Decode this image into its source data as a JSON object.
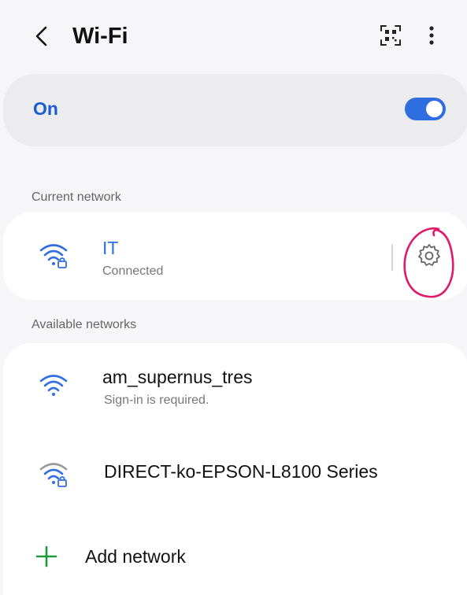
{
  "header": {
    "title": "Wi-Fi",
    "back_icon": "chevron-left-icon",
    "qr_icon": "qr-scan-icon",
    "more_icon": "more-vertical-icon"
  },
  "wifi_toggle": {
    "label": "On",
    "enabled": true,
    "accent_color": "#2f6ee0",
    "label_color": "#1c5bd6"
  },
  "current_network": {
    "section_label": "Current network",
    "name": "IT",
    "status": "Connected",
    "icon": "wifi-lock-icon",
    "settings_icon": "gear-icon",
    "name_color": "#2f6ee0"
  },
  "available_networks": {
    "section_label": "Available networks",
    "items": [
      {
        "name": "am_supernus_tres",
        "subtitle": "Sign-in is required.",
        "icon": "wifi-icon"
      },
      {
        "name": "DIRECT-ko-EPSON-L8100 Series",
        "subtitle": "",
        "icon": "wifi-lock-icon"
      }
    ]
  },
  "add_network": {
    "label": "Add network",
    "icon": "plus-icon",
    "icon_color": "#1e9a3c"
  },
  "annotation": {
    "color": "#e0186b"
  }
}
